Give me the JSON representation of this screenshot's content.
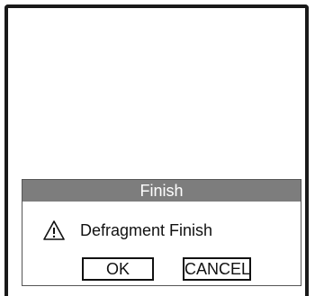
{
  "dialog": {
    "title": "Finish",
    "message": "Defragment Finish",
    "icon": "warning-icon",
    "ok_label": "OK",
    "cancel_label": "CANCEL"
  }
}
